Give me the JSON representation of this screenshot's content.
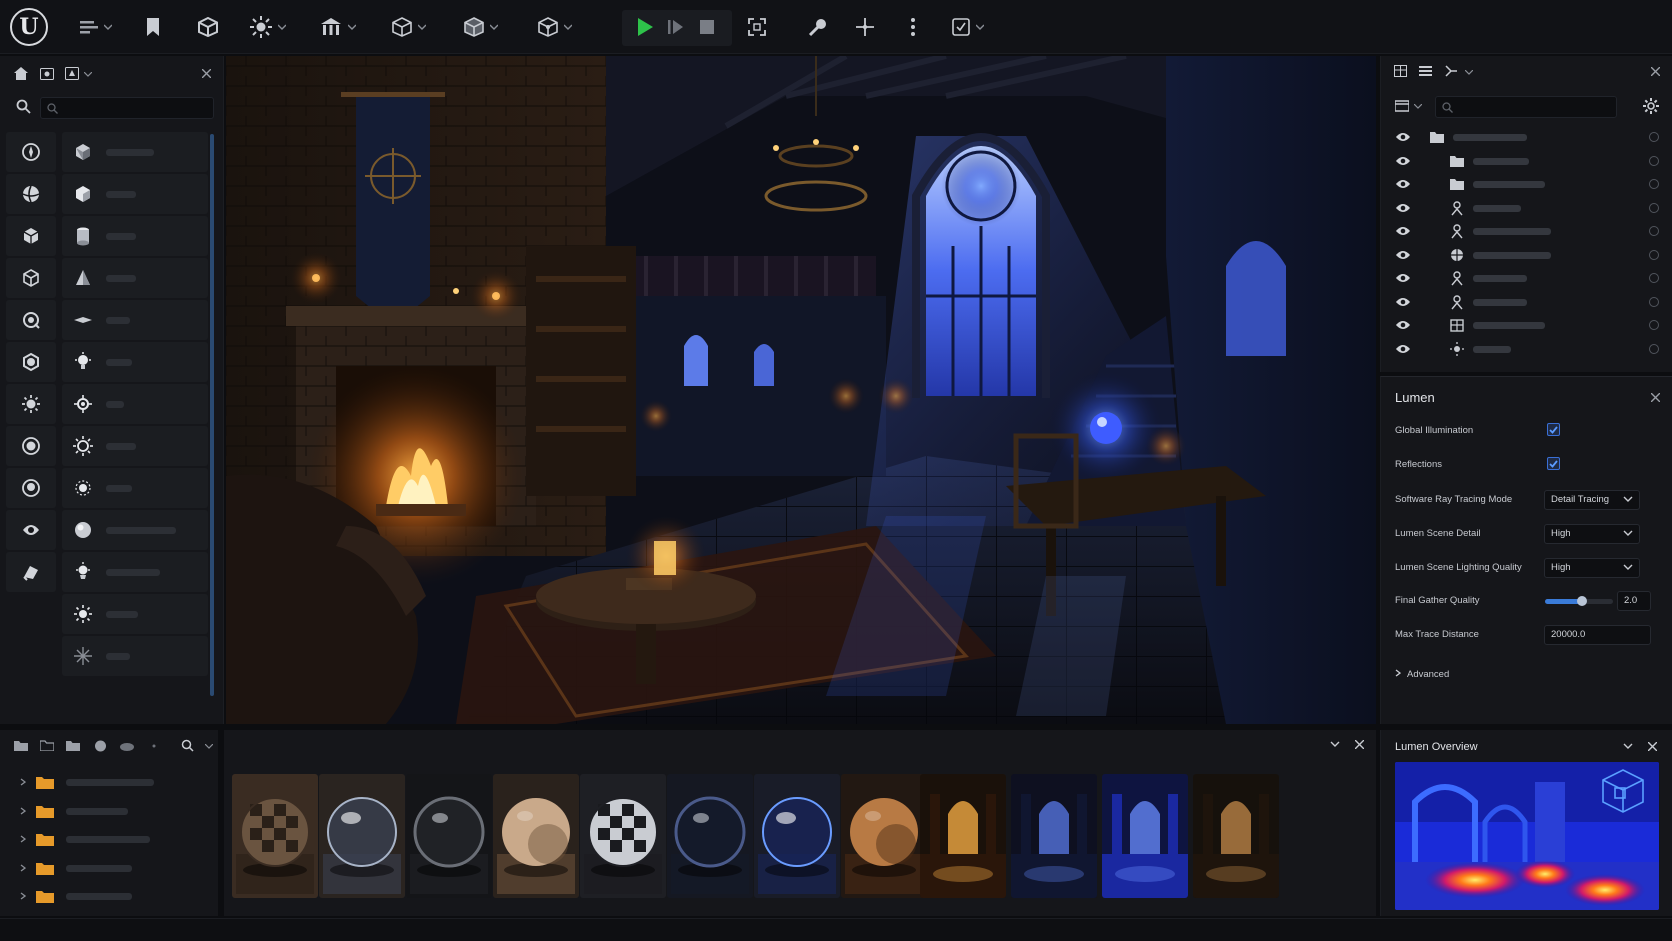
{
  "toolbar": {
    "logo": "U",
    "icons": [
      "hamburger-icon",
      "bookmark-icon",
      "cube-icon",
      "sun-icon",
      "building-icon",
      "box-outline-icon",
      "box-solid-icon",
      "box-wire-icon",
      "play-icon",
      "step-icon",
      "stop-icon",
      "fullscreen-icon",
      "wrench-icon",
      "transform-icon",
      "more-icon",
      "layout-icon"
    ],
    "accent": "#2ec24a"
  },
  "placement": {
    "categories": [
      "compass-icon",
      "sphere-icon",
      "cube-icon",
      "cube-outline-icon",
      "globe-icon",
      "hexagon-icon",
      "sun-icon",
      "orb-icon",
      "target-icon",
      "eye-shape-icon",
      "brush-icon"
    ],
    "items": [
      "cube",
      "cube-glossy",
      "cylinder",
      "cone",
      "plane",
      "bulb",
      "bulb-gear",
      "sun-light",
      "sun-ring",
      "sphere",
      "bulb-spot",
      "sun",
      "sparkle"
    ]
  },
  "lumen": {
    "title": "Lumen",
    "global_illumination": {
      "label": "Global Illumination",
      "checked": true
    },
    "reflections": {
      "label": "Reflections",
      "checked": true
    },
    "sw_mode": {
      "label": "Software Ray Tracing Mode",
      "value": "Detail Tracing"
    },
    "scene_detail": {
      "label": "Lumen Scene Detail",
      "value": "High"
    },
    "lighting_quality": {
      "label": "Lumen Scene Lighting Quality",
      "value": "High"
    },
    "final_gather": {
      "label": "Final Gather Quality",
      "value": "2.0",
      "fraction": 0.55
    },
    "max_trace": {
      "label": "Max Trace Distance",
      "value": "20000.0"
    },
    "advanced": "Advanced"
  },
  "overview": {
    "title": "Lumen Overview"
  },
  "colors": {
    "accent_blue": "#3a7bd8",
    "folder": "#e69a2a",
    "panel": "#15161a"
  }
}
